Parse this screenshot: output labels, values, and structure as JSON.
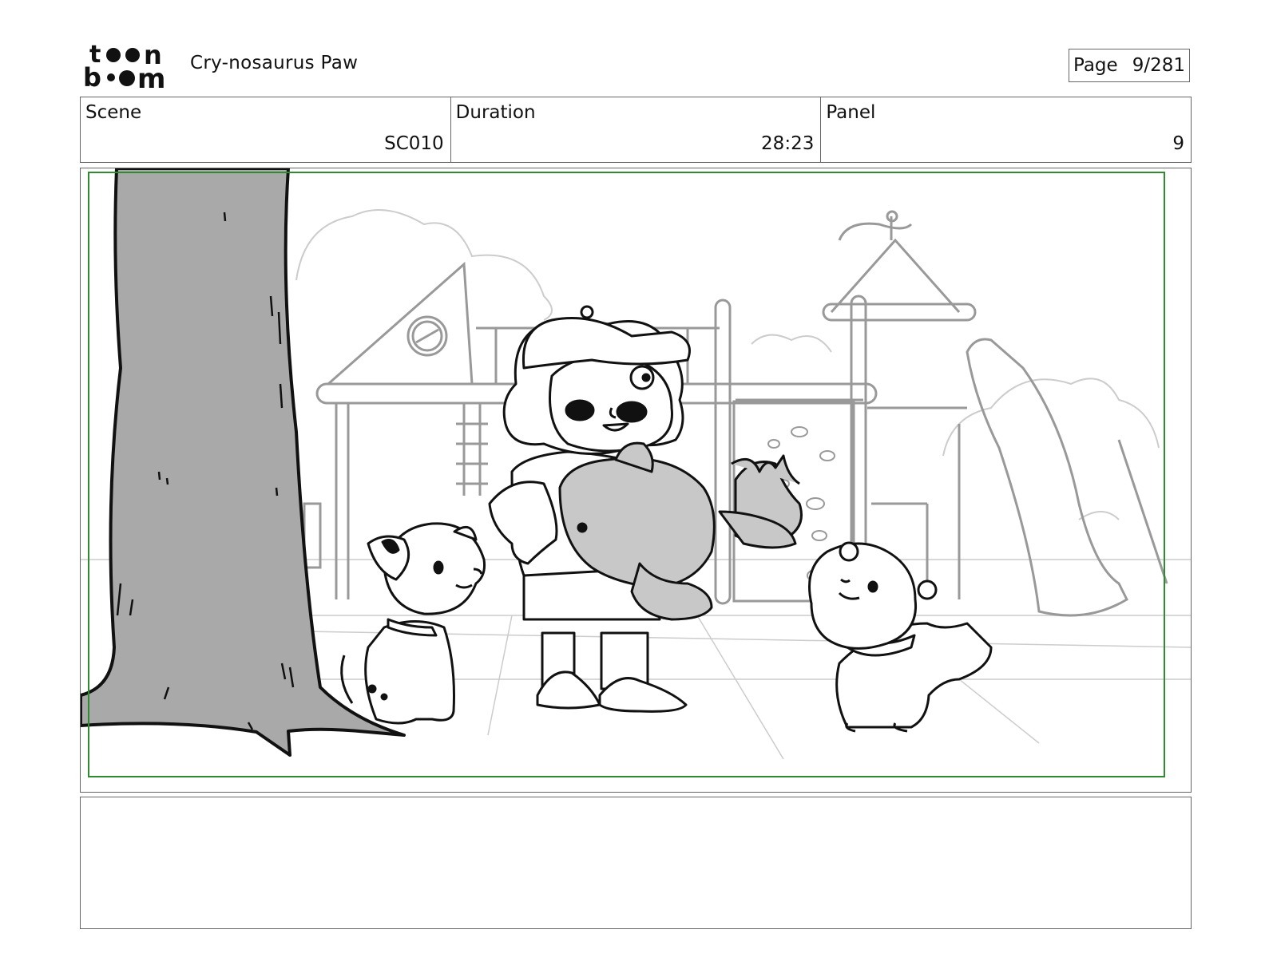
{
  "header": {
    "logo_text": "toon boom",
    "project_title": "Cry-nosaurus Paw",
    "page_label": "Page",
    "page_value": "9/281"
  },
  "info": {
    "scene_label": "Scene",
    "scene_value": "SC010",
    "duration_label": "Duration",
    "duration_value": "28:23",
    "panel_label": "Panel",
    "panel_value": "9"
  },
  "panel": {
    "safe_frame_color": "#2e8b2e",
    "tree_fill": "#a9a9a9",
    "character_fill": "#c8c8c8"
  },
  "notes": {
    "text": ""
  }
}
